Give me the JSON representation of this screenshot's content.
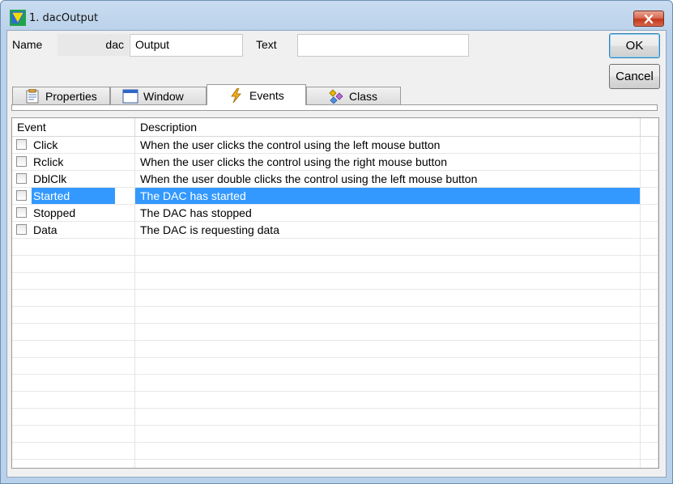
{
  "window": {
    "title": "1. dacOutput"
  },
  "form": {
    "name_label": "Name",
    "name_prefix": "dac",
    "name_value": "Output",
    "text_label": "Text",
    "text_value": ""
  },
  "buttons": {
    "ok": "OK",
    "cancel": "Cancel"
  },
  "tabs": [
    {
      "label": "Properties",
      "icon": "properties-icon",
      "active": false
    },
    {
      "label": "Window",
      "icon": "window-icon",
      "active": false
    },
    {
      "label": "Events",
      "icon": "lightning-icon",
      "active": true
    },
    {
      "label": "Class",
      "icon": "class-icon",
      "active": false
    }
  ],
  "events_table": {
    "columns": [
      "Event",
      "Description"
    ],
    "rows": [
      {
        "event": "Click",
        "description": "When the user clicks the control using the left mouse button",
        "checked": false,
        "selected": false
      },
      {
        "event": "Rclick",
        "description": "When the user clicks the control using the right mouse button",
        "checked": false,
        "selected": false
      },
      {
        "event": "DblClk",
        "description": "When the user double clicks the control using the left mouse button",
        "checked": false,
        "selected": false
      },
      {
        "event": "Started",
        "description": "The DAC has started",
        "checked": false,
        "selected": true
      },
      {
        "event": "Stopped",
        "description": "The DAC has stopped",
        "checked": false,
        "selected": false
      },
      {
        "event": "Data",
        "description": "The DAC is requesting data",
        "checked": false,
        "selected": false
      }
    ]
  },
  "colors": {
    "selection": "#3399ff",
    "title_bar": "#b9d1ea",
    "close_button": "#c3381c"
  }
}
